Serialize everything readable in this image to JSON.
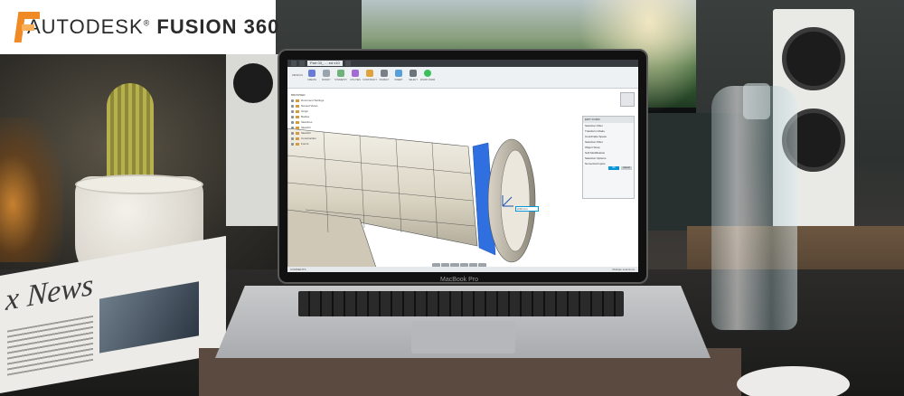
{
  "brand": {
    "company": "AUTODESK",
    "registered_mark": "®",
    "product": "FUSION 360",
    "accent_color": "#f08a24"
  },
  "laptop": {
    "model_label": "MacBook Pro"
  },
  "newspaper": {
    "masthead_fragment": "x News"
  },
  "app": {
    "tabs": [
      {
        "label": ""
      },
      {
        "label": ""
      },
      {
        "label": "Part 03_ ... ed v10"
      },
      {
        "label": ""
      }
    ],
    "workspace_switch": "DESIGN",
    "toolbar_groups": [
      {
        "label": "CREATE",
        "color": "#6a7bd6"
      },
      {
        "label": "MODIFY",
        "color": "#9aa4ad"
      },
      {
        "label": "SYMMETRY",
        "color": "#6fb37a"
      },
      {
        "label": "UTILITIES",
        "color": "#a46bd6"
      },
      {
        "label": "CONSTRUCT",
        "color": "#e0a23c"
      },
      {
        "label": "INSPECT",
        "color": "#7a8088"
      },
      {
        "label": "INSERT",
        "color": "#5aa0d8"
      },
      {
        "label": "SELECT",
        "color": "#6b737b"
      },
      {
        "label": "FINISH FORM",
        "color": "#3bbf5a"
      }
    ],
    "browser_items": [
      {
        "label": "BROWSER"
      },
      {
        "label": "Document Settings"
      },
      {
        "label": "Named Views"
      },
      {
        "label": "Origin"
      },
      {
        "label": "Bodies"
      },
      {
        "label": "Sketches"
      },
      {
        "label": "Sketch1"
      },
      {
        "label": "Sketch2"
      },
      {
        "label": "Construction"
      },
      {
        "label": "Form1"
      }
    ],
    "dialog": {
      "title": "EDIT FORM",
      "rows": [
        {
          "label": "Selection Filter",
          "value": ""
        },
        {
          "label": "Transform Mode",
          "value": ""
        },
        {
          "label": "Coordinate Space",
          "value": ""
        },
        {
          "label": "Selection Filter",
          "value": ""
        },
        {
          "label": "Object Snap",
          "value": ""
        },
        {
          "label": "Soft Modification",
          "value": ""
        },
        {
          "label": "Selection Options",
          "value": ""
        },
        {
          "label": "Numerical Inputs",
          "value": ""
        }
      ],
      "ok_label": "OK",
      "cancel_label": "Cancel"
    },
    "dimension_input": "0.00 mm",
    "status_left": "COMMENTS",
    "status_right": "Multiple selections"
  }
}
